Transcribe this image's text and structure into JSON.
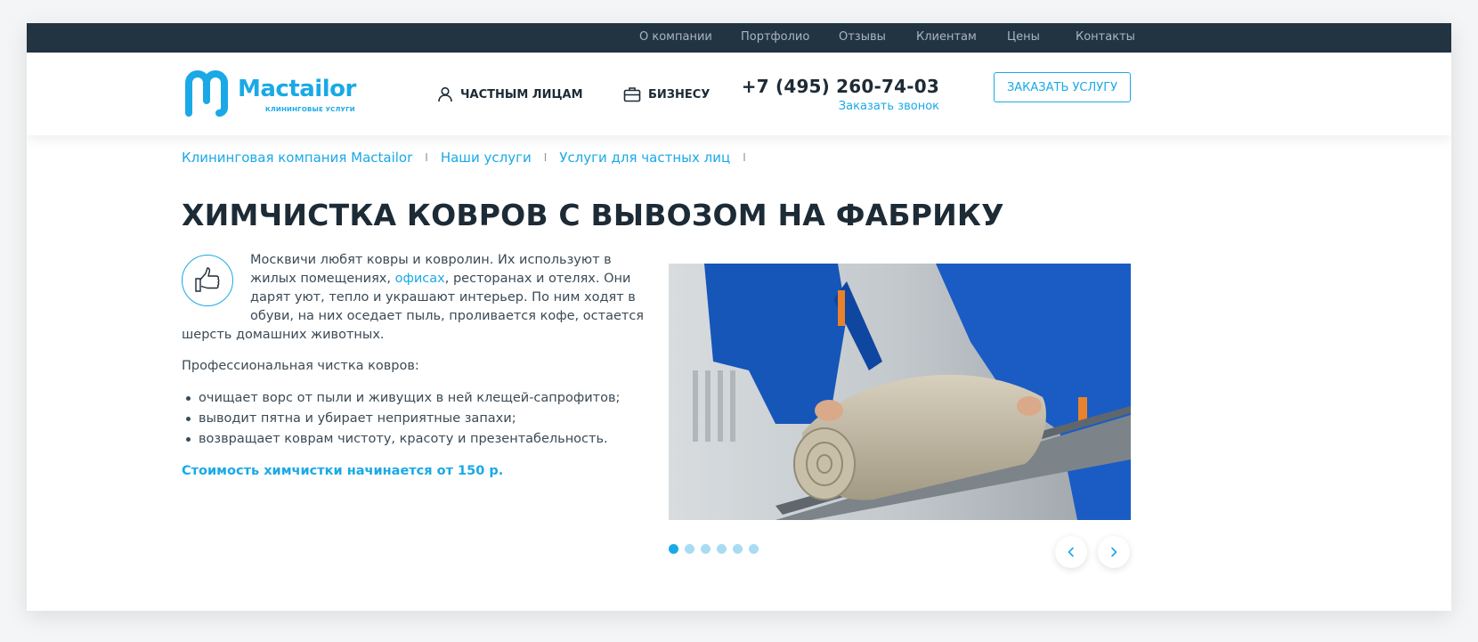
{
  "topbar": {
    "links": [
      "О компании",
      "Портфолио",
      "Отзывы",
      "Клиентам",
      "Цены",
      "Контакты"
    ]
  },
  "header": {
    "logo": {
      "word": "Mactailor",
      "subtitle": "КЛИНИНГОВЫЕ УСЛУГИ"
    },
    "nav": {
      "private": "ЧАСТНЫМ ЛИЦАМ",
      "business": "БИЗНЕСУ"
    },
    "phone": "+7 (495) 260-74-03",
    "callback": "Заказать звонок",
    "order_button": "ЗАКАЗАТЬ УСЛУГУ"
  },
  "breadcrumb": [
    "Клининговая компания Mactailor",
    "Наши услуги",
    "Услуги для частных лиц"
  ],
  "breadcrumb_separator": "I",
  "page": {
    "title": "ХИМЧИСТКА КОВРОВ С ВЫВОЗОМ НА ФАБРИКУ",
    "intro_before": "Москвичи любят ковры и ковролин. Их используют в жилых помещениях, ",
    "intro_link": "офисах",
    "intro_after": ", ресторанах и отелях. Они дарят уют, тепло и украшают интерьер. По ним ходят в обуви, на них оседает пыль, проливается кофе, остается шерсть домашних животных.",
    "list_title": "Профессиональная чистка ковров:",
    "list": [
      "очищает ворс от пыли и живущих в ней клещей-сапрофитов;",
      "выводит пятна и убирает неприятные запахи;",
      "возвращает коврам чистоту, красоту и презентабельность."
    ],
    "price": "Стоимость химчистки начинается от 150 р."
  },
  "slider": {
    "count": 6,
    "active": 0
  },
  "colors": {
    "accent": "#1aa9e6",
    "dark": "#223341",
    "text": "#1d2b36"
  },
  "icons": [
    "user-icon",
    "briefcase-icon",
    "thumbs-up-icon",
    "chevron-left-icon",
    "chevron-right-icon"
  ]
}
